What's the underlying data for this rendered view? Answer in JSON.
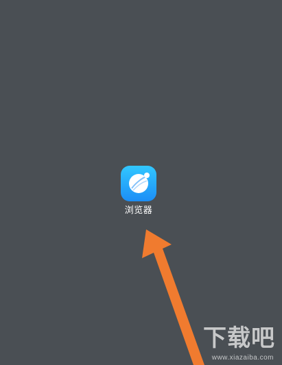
{
  "home_screen": {
    "app": {
      "label": "浏览器",
      "icon_name": "browser-globe-icon",
      "icon_colors": [
        "#32c7ff",
        "#1c8ef6"
      ],
      "label_color": "#ffffff"
    },
    "annotation": {
      "arrow_color": "#f07b2f"
    },
    "watermark": {
      "brand": "下载吧",
      "url": "www.xiazaiba.com"
    }
  }
}
